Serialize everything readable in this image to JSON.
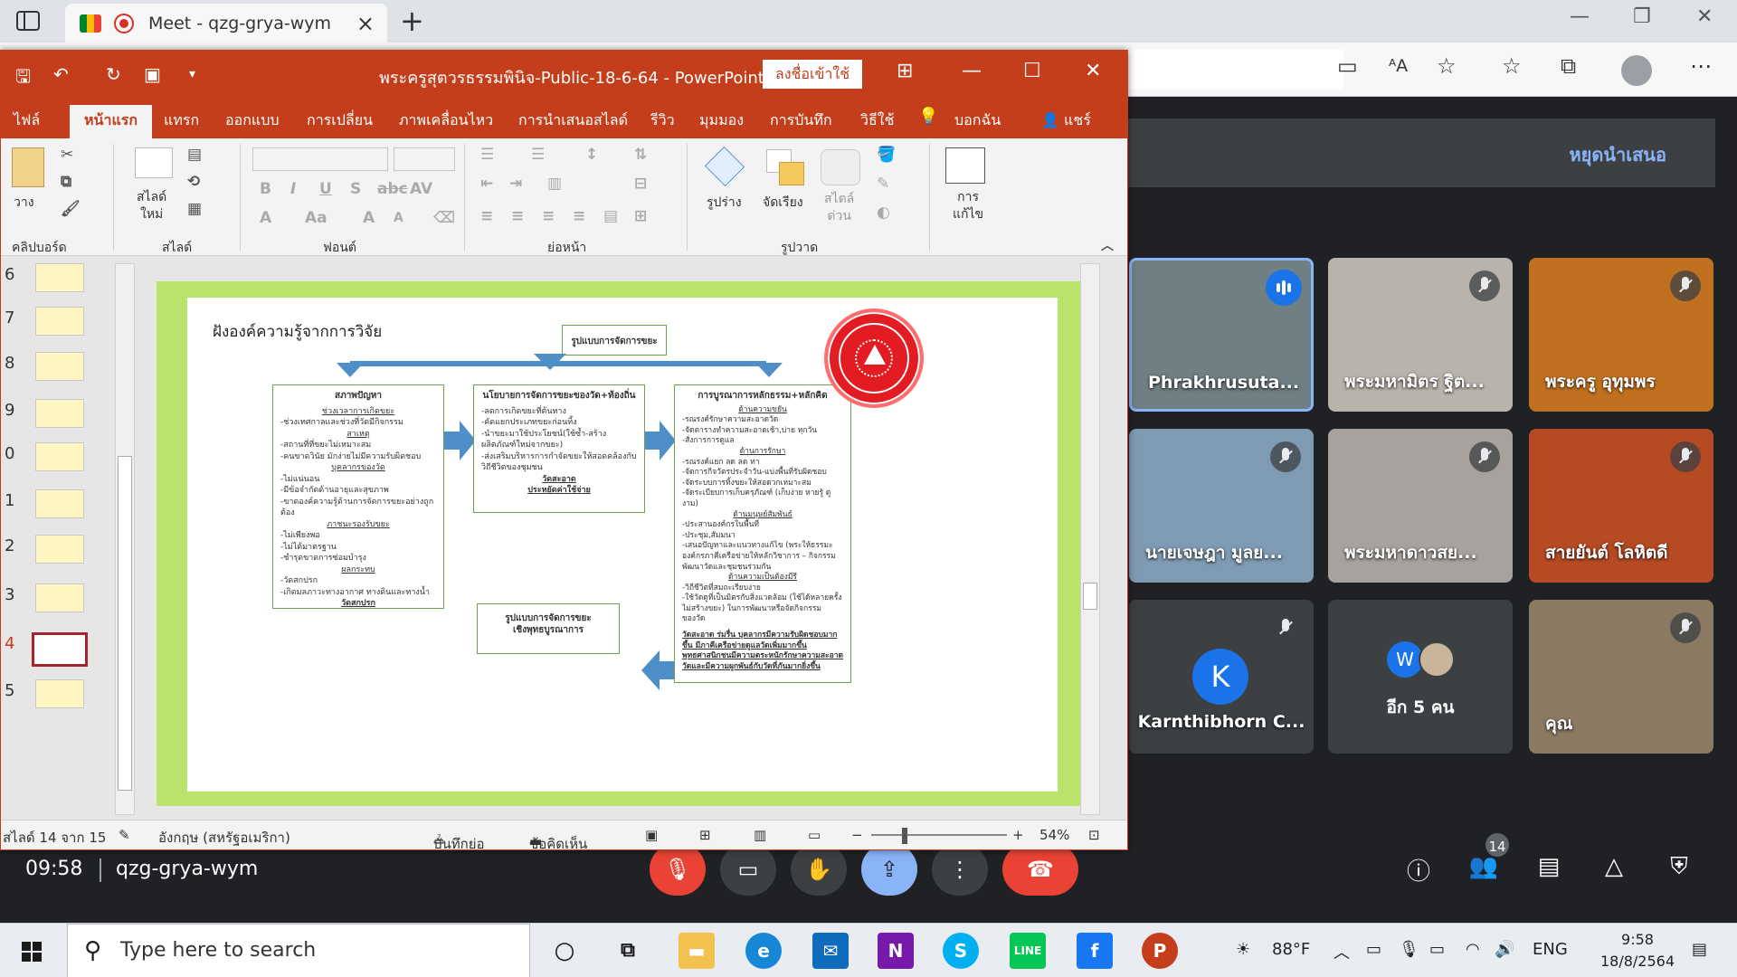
{
  "browser": {
    "tab_title": "Meet - qzg-grya-wym",
    "tab_close": "×",
    "new_tab": "+",
    "win_minimize": "—",
    "win_restore": "❐",
    "win_close": "✕"
  },
  "ppt": {
    "doc_title": "พระครูสุตวรธรรมพินิจ-Public-18-6-64  -  PowerPoint",
    "sign_in": "ลงชื่อเข้าใช้",
    "tabs": [
      "ไฟล์",
      "หน้าแรก",
      "แทรก",
      "ออกแบบ",
      "การเปลี่ยน",
      "ภาพเคลื่อนไหว",
      "การนำเสนอสไลด์",
      "รีวิว",
      "มุมมอง",
      "การบันทึก",
      "วิธีใช้",
      "บอกฉัน",
      "แชร์"
    ],
    "ribbon": {
      "paste": "วาง",
      "new_slide_line1": "สไลด์",
      "new_slide_line2": "ใหม่",
      "shapes": "รูปร่าง",
      "arrange": "จัดเรียง",
      "quick_styles_line1": "สไตล์",
      "quick_styles_line2": "ด่วน",
      "editing_line1": "การ",
      "editing_line2": "แก้ไข",
      "groups": {
        "clipboard": "คลิปบอร์ด",
        "slides": "สไลด์",
        "font": "ฟอนต์",
        "paragraph": "ย่อหน้า",
        "drawing": "รูปวาด"
      }
    },
    "thumbnail_numbers": [
      "6",
      "7",
      "8",
      "9",
      "0",
      "1",
      "2",
      "3",
      "4",
      "5"
    ],
    "status": {
      "slide_counter": "สไลด์  14 จาก 15",
      "language": "อังกฤษ (สหรัฐอเมริกา)",
      "notes": "บันทึกย่อ",
      "comments": "ข้อคิดเห็น",
      "zoom": "54%"
    }
  },
  "slide": {
    "title": "ฝังองค์ความรู้จากการวิจัย",
    "top_box": "รูปแบบการจัดการขยะ",
    "box_left": {
      "heading": "สภาพปัญหา",
      "lines": [
        {
          "t": "ช่วงเวลาการเกิดขยะ",
          "s": "u"
        },
        {
          "t": "-ช่วงเทศกาลและช่วงที่วัดมีกิจกรรม",
          "s": ""
        },
        {
          "t": "สาเหตุ",
          "s": "u"
        },
        {
          "t": "-สถานที่ที่ขยะไม่เหมาะสม",
          "s": ""
        },
        {
          "t": "-คนขาดวินัย มักง่ายไม่มีความรับผิดชอบ",
          "s": ""
        },
        {
          "t": "บุคลากรของวัด",
          "s": "u"
        },
        {
          "t": "-ไม่แน่นอน",
          "s": ""
        },
        {
          "t": "-มีข้อจำกัดด้านอายุและสุขภาพ",
          "s": ""
        },
        {
          "t": "-ขาดองค์ความรู้ด้านการจัดการขยะอย่างถูกต้อง",
          "s": ""
        },
        {
          "t": "ภาชนะรองรับขยะ",
          "s": "u"
        },
        {
          "t": "-ไม่เพียงพอ",
          "s": ""
        },
        {
          "t": "-ไม่ได้มาตรฐาน",
          "s": ""
        },
        {
          "t": "-ชำรุดขาดการซ่อมบำรุง",
          "s": ""
        },
        {
          "t": "ผลกระทบ",
          "s": "u"
        },
        {
          "t": "-วัดสกปรก",
          "s": ""
        },
        {
          "t": "-เกิดมลภาวะทางอากาศ ทางดินและทางน้ำ",
          "s": ""
        },
        {
          "t": "วัดสกปรก",
          "s": "b"
        }
      ]
    },
    "box_mid": {
      "heading": "นโยบายการจัดการขยะของวัด+ท้องถิ่น",
      "lines": [
        {
          "t": "-ลดการเกิดขยะที่ต้นทาง",
          "s": ""
        },
        {
          "t": "-คัดแยกประเภทขยะก่อนทิ้ง",
          "s": ""
        },
        {
          "t": "-นำขยะมาใช้ประโยชน์(ใช้ซ้ำ-สร้างผลิตภัณฑ์ใหม่จากขยะ)",
          "s": ""
        },
        {
          "t": "-ส่งเสริมบริหารการกำจัดขยะให้สอดคล้องกับวิถีชีวิตของชุมชน",
          "s": ""
        },
        {
          "t": "วัดสะอาด",
          "s": "b"
        },
        {
          "t": "ประหยัดค่าใช้จ่าย",
          "s": "b"
        }
      ]
    },
    "box_right": {
      "heading": "การบูรณาการหลักธรรม+หลักคิด",
      "lines": [
        {
          "t": "ด้านความขยัน",
          "s": "u"
        },
        {
          "t": "-รณรงค์รักษาความสะอาดวัด",
          "s": ""
        },
        {
          "t": "-จัดตารางทำความสะอาดเช้า,บ่าย ทุกวัน",
          "s": ""
        },
        {
          "t": "-สั่งการการดูแล",
          "s": ""
        },
        {
          "t": "ด้านการรักษา",
          "s": "u"
        },
        {
          "t": "-รณรงค์แยก ลด ลด ทา",
          "s": ""
        },
        {
          "t": "-จัดการกิจวัตรประจำวัน-แบ่งพื้นที่รับผิดชอบ",
          "s": ""
        },
        {
          "t": "-จัดระบบการทิ้งขยะให้สอดวกเหมาะสม",
          "s": ""
        },
        {
          "t": "-จัดระเบียบการเก็บครุภัณฑ์ (เก็บง่าย หายรู้ ดูงาม)",
          "s": ""
        },
        {
          "t": "ด้านมนุษย์สัมพันธ์",
          "s": "u"
        },
        {
          "t": "-ประสานองค์กรในพื้นที่",
          "s": ""
        },
        {
          "t": "-ประชุม,สัมมนา",
          "s": ""
        },
        {
          "t": "-เสนอปัญหาและแนวทางแก้ไข (พระให้ธรรมะ องค์กรภาคีเครือข่ายให้หลักวิชาการ – กิจกรรมพัฒนาวัดและชุมชนร่วมกัน",
          "s": ""
        },
        {
          "t": "ด้านความเป็นต้องมีรี",
          "s": "u"
        },
        {
          "t": "-วิถีชีวิตที่สมถะเรียบง่าย",
          "s": ""
        },
        {
          "t": "-ใช้วัดดูที่เป็นมิตรกับสิ่งแวดล้อม (ใช้ได้หลายครั้งไม่สร้างขยะ) ในการพัฒนาหรือจัดกิจกรรมของวัด",
          "s": ""
        },
        {
          "t": "วัดสะอาด ร่มรื่น บุคลากรมีความรับผิดชอบมากขึ้น มีภาคีเครือข่ายดูแลวัดเพิ่มมากขึ้น พุทธศาสนิกชนมีความตระหนักรักษาความสะอาดวัดและมีความผูกพันธ์กับวัดที่ภันมากยิ่งขึ้น",
          "s": "bl"
        }
      ]
    },
    "bottom_box_line1": "รูปแบบการจัดการขยะ",
    "bottom_box_line2": "เชิงพุทธบูรณาการ"
  },
  "meet": {
    "stop_presenting": "หยุดนำเสนอ",
    "participants": [
      {
        "name": "Phrakhrusuta...",
        "bg": "#6f7f84",
        "speaking": true
      },
      {
        "name": "พระมหามิตร ฐิต...",
        "bg": "#b9b4ab",
        "speaking": false
      },
      {
        "name": "พระครู อุทุมพร",
        "bg": "#c0711f",
        "speaking": false
      },
      {
        "name": "นายเจษฎา มูลย...",
        "bg": "#7f9bb3",
        "speaking": false
      },
      {
        "name": "พระมหาดาวสย...",
        "bg": "#a7a29d",
        "speaking": false
      },
      {
        "name": "สายยันต์ โลหิตดี",
        "bg": "#b64a22",
        "speaking": false
      },
      {
        "name": "Karnthibhorn C...",
        "bg": "#3c4043",
        "speaking": false,
        "initial": "K"
      },
      {
        "name": "อีก 5 คน",
        "bg": "#3c4043",
        "speaking": false,
        "initial": "W"
      },
      {
        "name": "คุณ",
        "bg": "#8a7a62",
        "speaking": false
      }
    ],
    "time": "09:58",
    "meeting_code": "qzg-grya-wym",
    "participant_count": "14"
  },
  "taskbar": {
    "search_placeholder": "Type here to search",
    "weather": "88°F",
    "language": "ENG",
    "time": "9:58",
    "date": "18/8/2564"
  },
  "colors": {
    "ppt_accent": "#c43e1c",
    "meet_bg": "#202124",
    "slide_border_green": "#b9e36a",
    "meet_blue": "#8ab4f8"
  }
}
